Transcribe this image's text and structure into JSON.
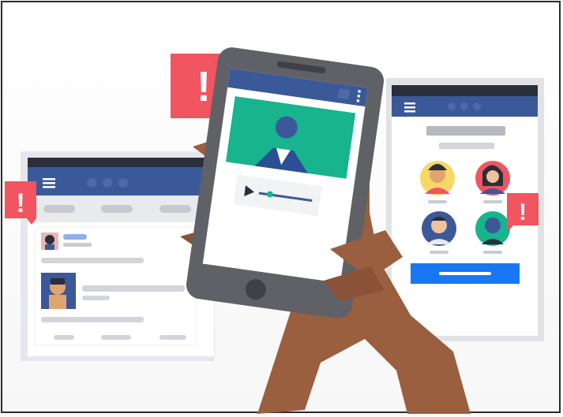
{
  "illustration": {
    "alert_symbol": "!",
    "colors": {
      "facebook_blue": "#3b5998",
      "navbar_dark": "#2b2e3b",
      "alert_red": "#f05560",
      "device_gray": "#5f6166",
      "screen_white": "#ffffff",
      "skin": "#9a5f3f",
      "cta_button": "#1877f2",
      "video_bg": "#17b48e"
    },
    "icons": [
      "hamburger-menu-icon",
      "alert-badge-icon",
      "play-icon",
      "more-vert-icon",
      "avatar-icon"
    ]
  }
}
